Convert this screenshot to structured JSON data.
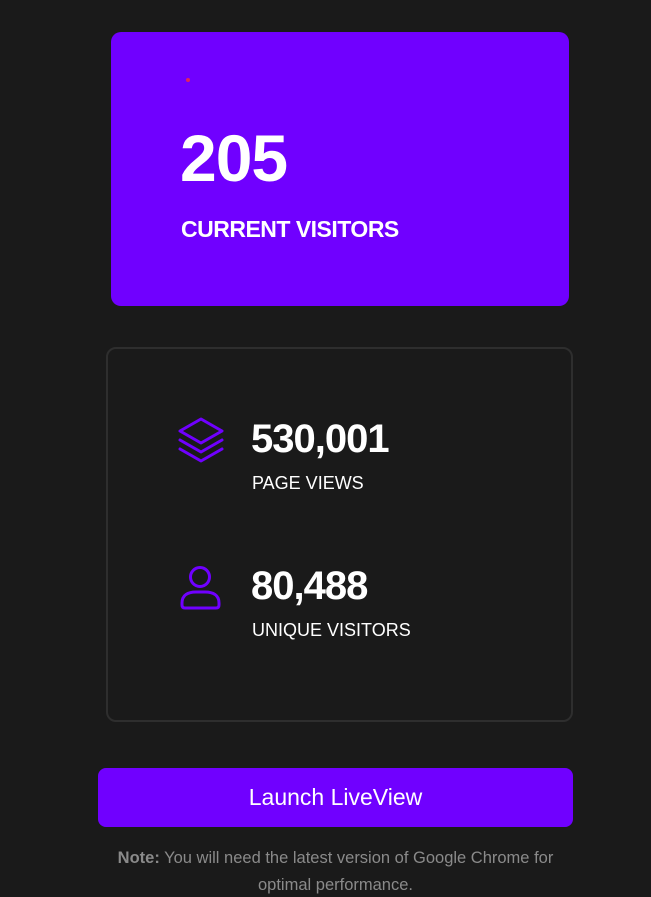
{
  "current_visitors": {
    "value": "205",
    "label": "CURRENT VISITORS",
    "live_dot_color": "#e0245e"
  },
  "stats": [
    {
      "value": "530,001",
      "label": "PAGE VIEWS",
      "icon": "layers-icon"
    },
    {
      "value": "80,488",
      "label": "UNIQUE VISITORS",
      "icon": "user-icon"
    }
  ],
  "launch_button": {
    "label": "Launch LiveView"
  },
  "note": {
    "prefix": "Note:",
    "text": " You will need the latest version of Google Chrome for optimal performance."
  },
  "colors": {
    "accent": "#7000ff",
    "background": "#1a1a1a",
    "card_border": "#2e2e2e",
    "text": "#ffffff",
    "muted_text": "#8a8a8a"
  }
}
